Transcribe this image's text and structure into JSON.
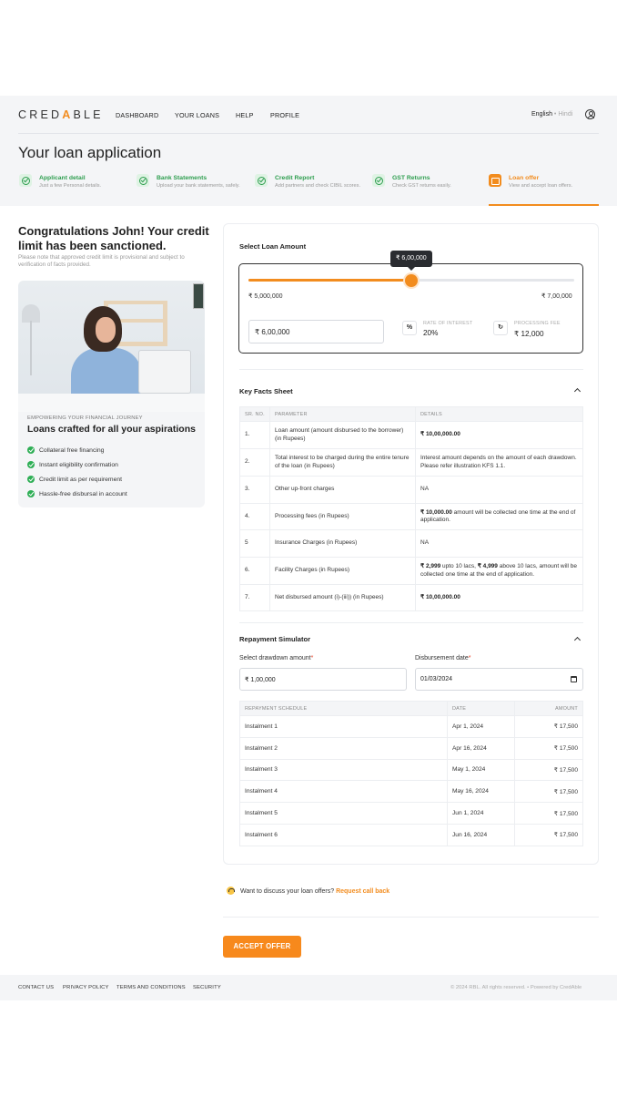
{
  "brand": {
    "logo_pre": "CRED",
    "logo_a": "A",
    "logo_post": "BLE",
    "accent": "#f28c1e"
  },
  "nav": {
    "items": [
      "DASHBOARD",
      "YOUR LOANS",
      "HELP",
      "PROFILE"
    ],
    "lang_active": "English",
    "lang_sep": " • ",
    "lang_other": "Hindi",
    "user_icon": "user-circle-icon"
  },
  "page_title": "Your loan application",
  "steps": [
    {
      "title": "Applicant detail",
      "sub": "Just a few Personal details.",
      "icon": "check-circle-icon"
    },
    {
      "title": "Bank Statements",
      "sub": "Upload your bank statements, safely.",
      "icon": "check-circle-icon"
    },
    {
      "title": "Credit Report",
      "sub": "Add partners and check CIBIL scores.",
      "icon": "check-circle-icon"
    },
    {
      "title": "GST Returns",
      "sub": "Check GST returns easily.",
      "icon": "check-circle-icon"
    },
    {
      "title": "Loan offer",
      "sub": "View and accept loan offers.",
      "icon": "briefcase-icon"
    }
  ],
  "congrats": {
    "title": "Congratulations John! Your credit limit has been sanctioned.",
    "note": "Please note that approved credit limit is provisional and subject to verification of facts provided."
  },
  "promo": {
    "kicker": "EMPOWERING YOUR FINANCIAL JOURNEY",
    "title": "Loans crafted for all your aspirations",
    "features": [
      "Collateral free financing",
      "Instant eligibility confirmation",
      "Credit limit as per requirement",
      "Hassle-free disbursal in account"
    ]
  },
  "loan": {
    "section_title": "Select Loan Amount",
    "tooltip": "₹ 6,00,000",
    "min_label": "₹ 5,000,000",
    "max_label": "₹ 7,00,000",
    "slider_fraction": 0.5,
    "input_value": "₹ 6,00,000",
    "roi_symbol": "%",
    "roi_label": "RATE OF INTEREST",
    "roi_value": "20%",
    "fee_label": "PROCESSING FEE",
    "fee_value": "₹ 12,000"
  },
  "kfs": {
    "title": "Key Facts Sheet",
    "headers": [
      "SR. NO.",
      "PARAMETER",
      "DETAILS"
    ],
    "rows": [
      {
        "no": "1.",
        "param": "Loan amount (amount disbursed to the borrower) (in Rupees)",
        "bold": "₹ 10,00,000.00",
        "details": ""
      },
      {
        "no": "2.",
        "param": "Total interest to be charged during the entire tenure of the loan (in Rupees)",
        "bold": "",
        "details": "Interest amount depends on the amount of each drawdown. Please refer illustration KFS 1.1."
      },
      {
        "no": "3.",
        "param": "Other up-front charges",
        "bold": "",
        "details": "NA"
      },
      {
        "no": "4.",
        "param": "Processing fees (in Rupees)",
        "bold": "₹ 10,000.00",
        "details": " amount will be collected one time at the end of application."
      },
      {
        "no": "5",
        "param": "Insurance Charges (in Rupees)",
        "bold": "",
        "details": "NA"
      },
      {
        "no": "6.",
        "param": "Facility Charges (in Rupees)",
        "bold": "₹ 2,999",
        "details": " upto 10 lacs, ",
        "bold2": "₹ 4,999",
        "details2": " above 10 lacs, amount will be collected one time at the end of application."
      },
      {
        "no": "7.",
        "param": "Net disbursed amount (i)-(iii)) (in Rupees)",
        "bold": "₹ 10,00,000.00",
        "details": ""
      }
    ]
  },
  "simulator": {
    "title": "Repayment Simulator",
    "drawdown_label": "Select drawdown amount",
    "drawdown_value": "₹ 1,00,000",
    "date_label": "Disbursement date",
    "date_value": "01/03/2024",
    "req": "*",
    "headers": [
      "REPAYMENT SCHEDULE",
      "DATE",
      "AMOUNT"
    ],
    "rows": [
      {
        "name": "Instalment 1",
        "date": "Apr 1, 2024",
        "amount": "₹ 17,500"
      },
      {
        "name": "Instalment 2",
        "date": "Apr 16, 2024",
        "amount": "₹ 17,500"
      },
      {
        "name": "Instalment 3",
        "date": "May 1, 2024",
        "amount": "₹ 17,500"
      },
      {
        "name": "Instalment 4",
        "date": "May 16, 2024",
        "amount": "₹ 17,500"
      },
      {
        "name": "Instalment 5",
        "date": "Jun 1, 2024",
        "amount": "₹ 17,500"
      },
      {
        "name": "Instalment 6",
        "date": "Jun 16, 2024",
        "amount": "₹ 17,500"
      }
    ]
  },
  "callback": {
    "text": "Want to discuss your loan offers? ",
    "link": "Request call back"
  },
  "accept_label": "ACCEPT OFFER",
  "footer": {
    "links": [
      "CONTACT US",
      "PRIVACY POLICY",
      "TERMS AND CONDITIONS",
      "SECURITY"
    ],
    "copyright": "© 2024 RBL. All rights reserved.  •  Powered by CredAble"
  }
}
